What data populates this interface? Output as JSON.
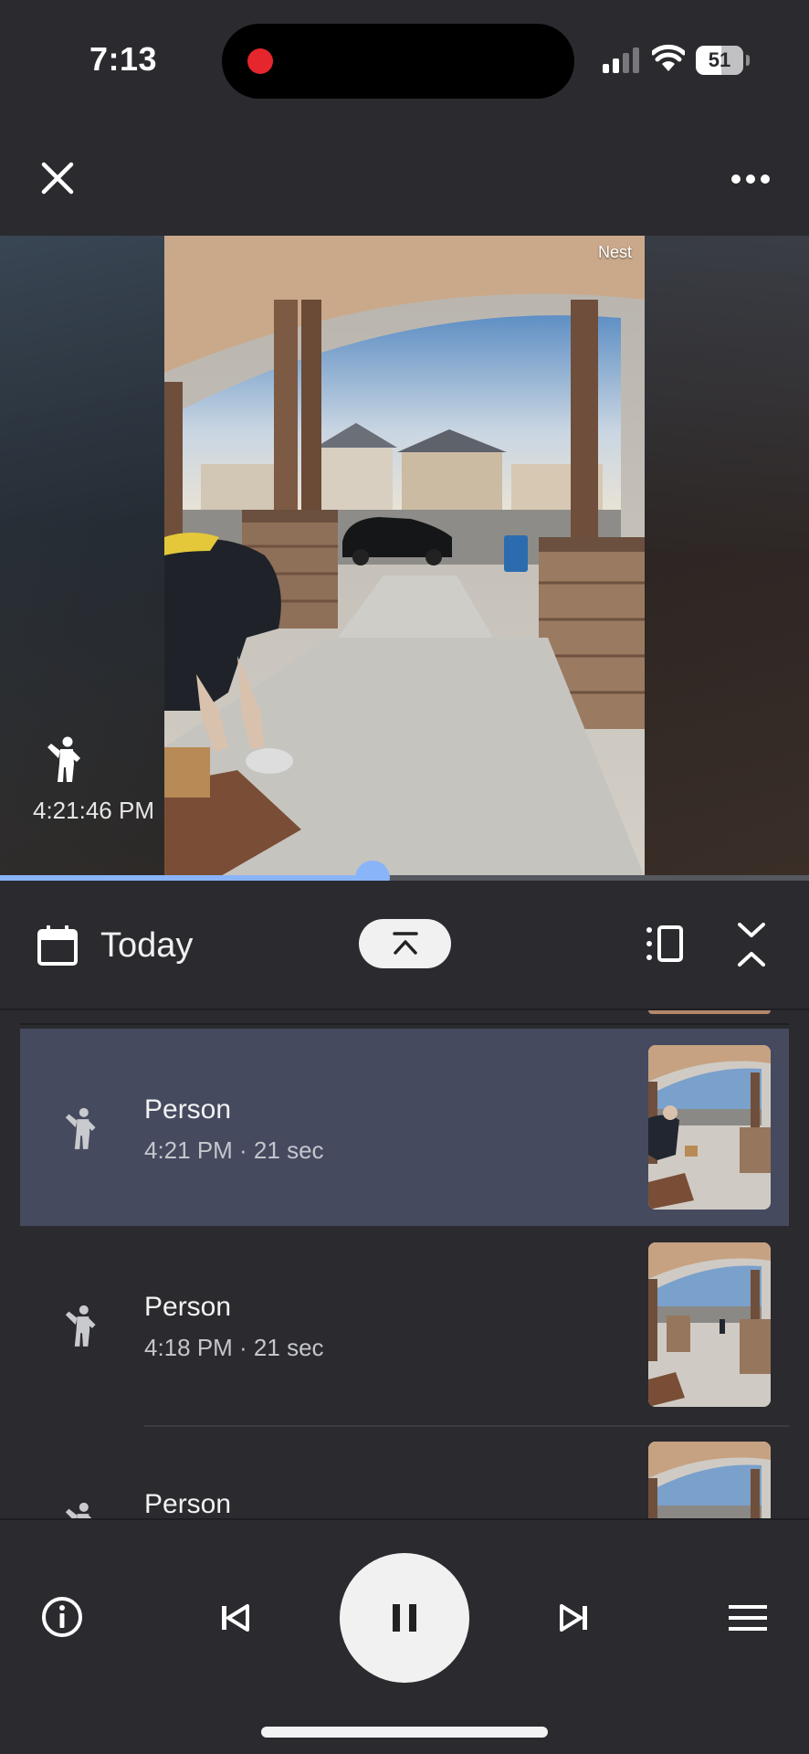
{
  "status_bar": {
    "time": "7:13",
    "battery_level": "51",
    "recording_indicator_color": "#e5262c"
  },
  "app_bar": {
    "close_icon": "close-icon",
    "more_icon": "more-horizontal-icon"
  },
  "video": {
    "watermark": "Nest",
    "event_icon": "person-motion-icon",
    "event_time": "4:21:46 PM",
    "scrubber_progress": 0.46,
    "accent_color": "#8ab4f8"
  },
  "date_bar": {
    "calendar_icon": "calendar-icon",
    "date_label": "Today",
    "jump_icon": "jump-to-top-icon",
    "view_icon": "view-toggle-icon",
    "collapse_icon": "collapse-icon"
  },
  "events": [
    {
      "title": "Person",
      "meta": "4:21 PM · 21 sec",
      "selected": true,
      "icon": "person-motion-icon"
    },
    {
      "title": "Person",
      "meta": "4:18 PM · 21 sec",
      "selected": false,
      "icon": "person-motion-icon"
    },
    {
      "title": "Person",
      "meta": "",
      "selected": false,
      "icon": "person-motion-icon"
    }
  ],
  "controls": {
    "info_icon": "info-icon",
    "previous_icon": "skip-previous-icon",
    "pause_icon": "pause-icon",
    "next_icon": "skip-next-icon",
    "menu_icon": "menu-icon"
  },
  "colors": {
    "background": "#2a2a2f",
    "selected_row": "#454a5f"
  }
}
